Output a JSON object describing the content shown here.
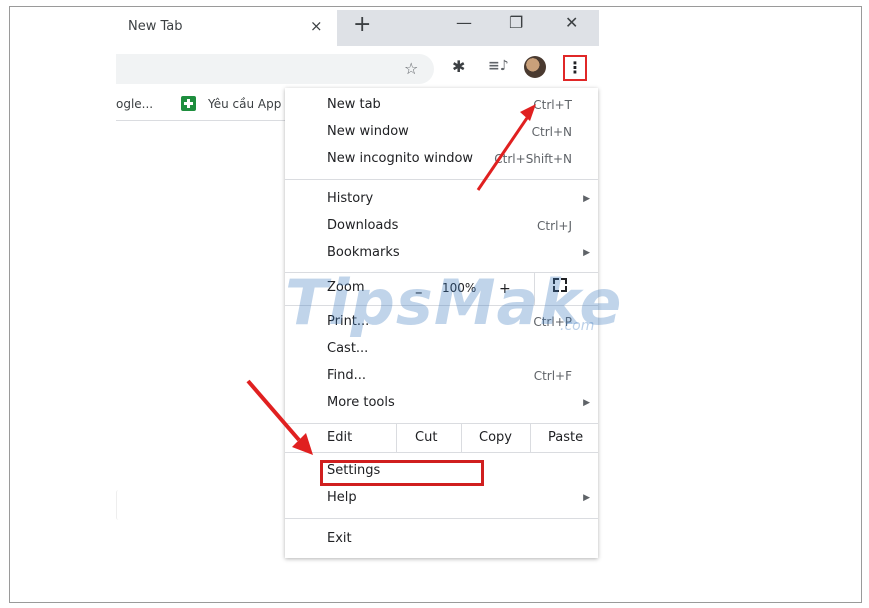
{
  "browser": {
    "tab_title": "New Tab",
    "tab_close": "×",
    "new_tab": "+",
    "minimize": "—",
    "restore": "❐",
    "close": "✕",
    "star": "☆",
    "extensions": "✱",
    "media": "≡♪",
    "menu_button": "⋮"
  },
  "bookmarks": [
    {
      "label": "ogle..."
    },
    {
      "label": "Yêu cầu App"
    }
  ],
  "menu": {
    "new_tab": {
      "label": "New tab",
      "shortcut": "Ctrl+T"
    },
    "new_window": {
      "label": "New window",
      "shortcut": "Ctrl+N"
    },
    "new_incognito": {
      "label": "New incognito window",
      "shortcut": "Ctrl+Shift+N"
    },
    "history": {
      "label": "History",
      "arrow": "▶"
    },
    "downloads": {
      "label": "Downloads",
      "shortcut": "Ctrl+J"
    },
    "bookmarks": {
      "label": "Bookmarks",
      "arrow": "▶"
    },
    "zoom": {
      "label": "Zoom",
      "minus": "–",
      "value": "100%",
      "plus": "+"
    },
    "print": {
      "label": "Print...",
      "shortcut": "Ctrl+P"
    },
    "cast": {
      "label": "Cast..."
    },
    "find": {
      "label": "Find...",
      "shortcut": "Ctrl+F"
    },
    "more_tools": {
      "label": "More tools",
      "arrow": "▶"
    },
    "edit": {
      "label": "Edit",
      "cut": "Cut",
      "copy": "Copy",
      "paste": "Paste"
    },
    "settings": {
      "label": "Settings"
    },
    "help": {
      "label": "Help",
      "arrow": "▶"
    },
    "exit": {
      "label": "Exit"
    }
  },
  "watermark": {
    "text": "TipsMake",
    "suffix": ".com"
  },
  "annotation_color": "#d01f1f"
}
